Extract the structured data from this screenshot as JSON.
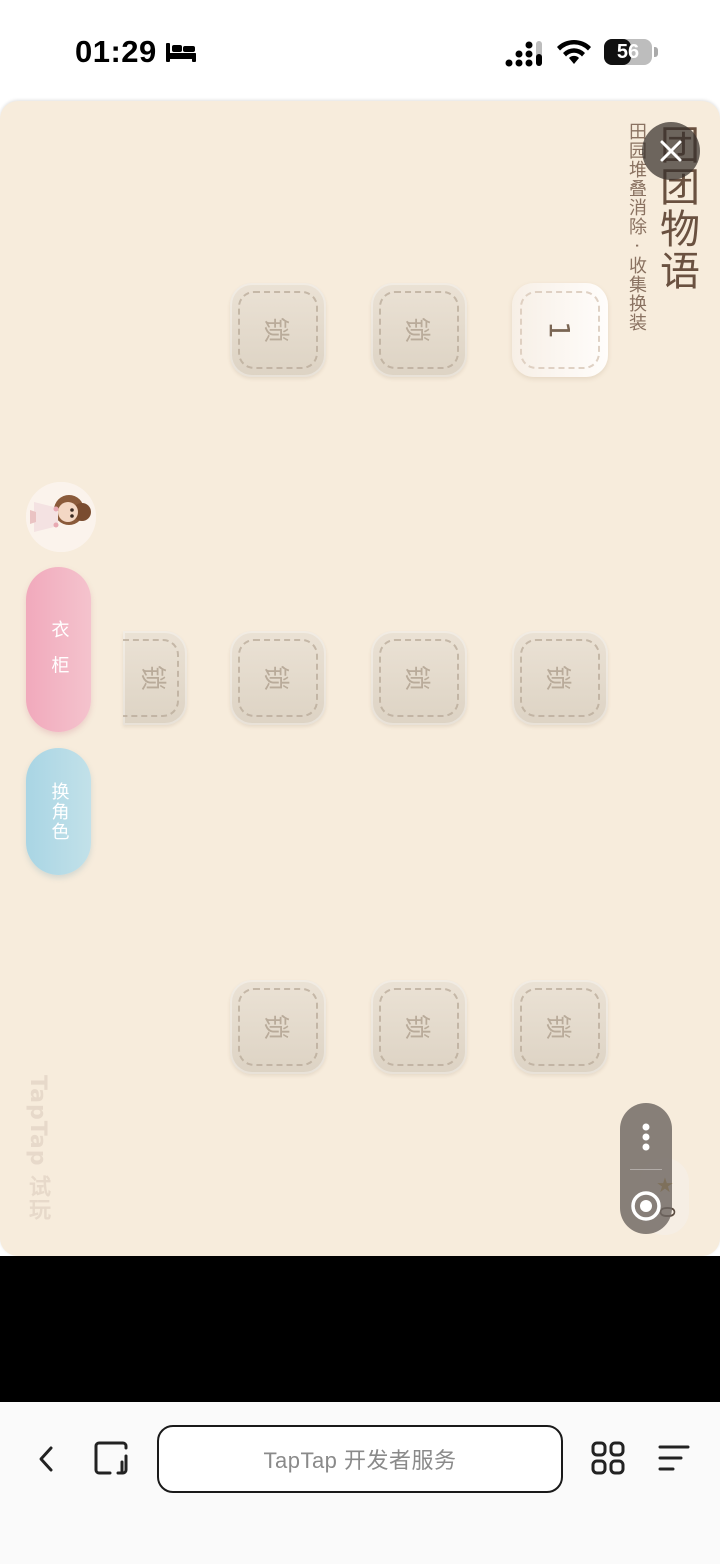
{
  "status_bar": {
    "time": "01:29",
    "battery_level": "56",
    "battery_fraction": 0.56,
    "icons": [
      "bed-icon",
      "signal-icon",
      "wifi-icon",
      "battery-icon"
    ]
  },
  "game": {
    "title": "团团物语",
    "subtitle": "田园堆叠消除 · 收集换装",
    "colors": {
      "background": "#f7ecdc",
      "tile": "#e6dccd",
      "title": "#6a5140",
      "wardrobe": "#f1a9bc",
      "change_role": "#a9d5e4"
    },
    "levels": [
      {
        "label": "1",
        "state": "unlocked"
      },
      {
        "label": "锁",
        "state": "locked"
      },
      {
        "label": "锁",
        "state": "locked"
      },
      {
        "label": "锁",
        "state": "locked"
      },
      {
        "label": "锁",
        "state": "locked"
      },
      {
        "label": "锁",
        "state": "locked"
      },
      {
        "label": "锁",
        "state": "locked"
      },
      {
        "label": "锁",
        "state": "locked"
      },
      {
        "label": "锁",
        "state": "locked"
      },
      {
        "label": "锁",
        "state": "locked"
      }
    ],
    "wardrobe_button": "衣 柜",
    "change_role_button": "换角色",
    "star_count": "0",
    "watermark": "TapTap 试玩"
  },
  "browser": {
    "address_text": "TapTap 开发者服务",
    "icons": [
      "back-icon",
      "window-icon",
      "apps-icon",
      "menu-icon",
      "more-icon",
      "target-icon",
      "close-icon"
    ]
  }
}
